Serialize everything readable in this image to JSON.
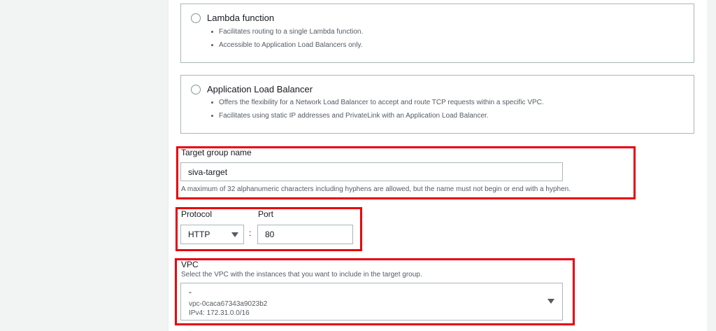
{
  "target_types": [
    {
      "title": "Lambda function",
      "bullets": [
        "Facilitates routing to a single Lambda function.",
        "Accessible to Application Load Balancers only."
      ]
    },
    {
      "title": "Application Load Balancer",
      "bullets": [
        "Offers the flexibility for a Network Load Balancer to accept and route TCP requests within a specific VPC.",
        "Facilitates using static IP addresses and PrivateLink with an Application Load Balancer."
      ]
    }
  ],
  "target_group_name": {
    "label": "Target group name",
    "value": "siva-target",
    "hint": "A maximum of 32 alphanumeric characters including hyphens are allowed, but the name must not begin or end with a hyphen."
  },
  "protocol": {
    "label": "Protocol",
    "value": "HTTP"
  },
  "separator": ":",
  "port": {
    "label": "Port",
    "value": "80"
  },
  "vpc": {
    "label": "VPC",
    "hint": "Select the VPC with the instances that you want to include in the target group.",
    "selected_name": "-",
    "selected_id": "vpc-0caca67343a9023b2",
    "selected_cidr": "IPv4: 172.31.0.0/16"
  },
  "colors": {
    "highlight": "#e8000b",
    "border": "#aab7b8",
    "muted_text": "#545b64"
  }
}
